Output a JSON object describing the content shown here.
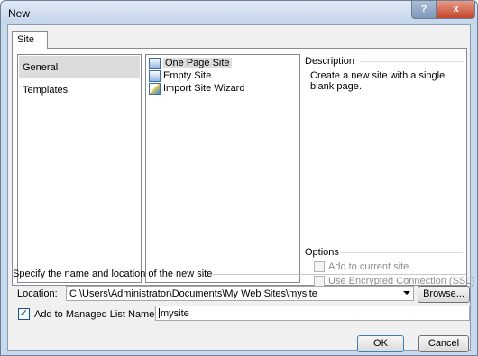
{
  "window": {
    "title": "New",
    "help_glyph": "?",
    "close_glyph": "x"
  },
  "tabs": [
    {
      "label": "Site",
      "active": true
    }
  ],
  "categories": [
    {
      "label": "General",
      "selected": true
    },
    {
      "label": "Templates",
      "selected": false
    }
  ],
  "templates": [
    {
      "label": "One Page Site",
      "icon": "page-icon",
      "selected": true
    },
    {
      "label": "Empty Site",
      "icon": "page-icon",
      "selected": false
    },
    {
      "label": "Import Site Wizard",
      "icon": "wizard-icon",
      "selected": false
    }
  ],
  "description": {
    "group_label": "Description",
    "text": "Create a new site with a single blank page."
  },
  "options": {
    "group_label": "Options",
    "add_to_current": {
      "label": "Add to current site",
      "checked": false,
      "enabled": false
    },
    "ssl": {
      "label": "Use Encrypted Connection (SSL)",
      "checked": false,
      "enabled": false
    }
  },
  "location_section": {
    "label": "Specify the name and location of the new site",
    "location_label": "Location:",
    "location_value": "C:\\Users\\Administrator\\Documents\\My Web Sites\\mysite",
    "browse_label": "Browse..."
  },
  "managed": {
    "checkbox_label": "Add to Managed List",
    "checked": true,
    "check_glyph": "✓",
    "name_label": "Name:",
    "name_value": "mysite"
  },
  "buttons": {
    "ok": "OK",
    "cancel": "Cancel"
  },
  "colors": {
    "selection": "#dcdcdc",
    "title_bar": "#c9d9ec",
    "close_button": "#c4452b"
  }
}
